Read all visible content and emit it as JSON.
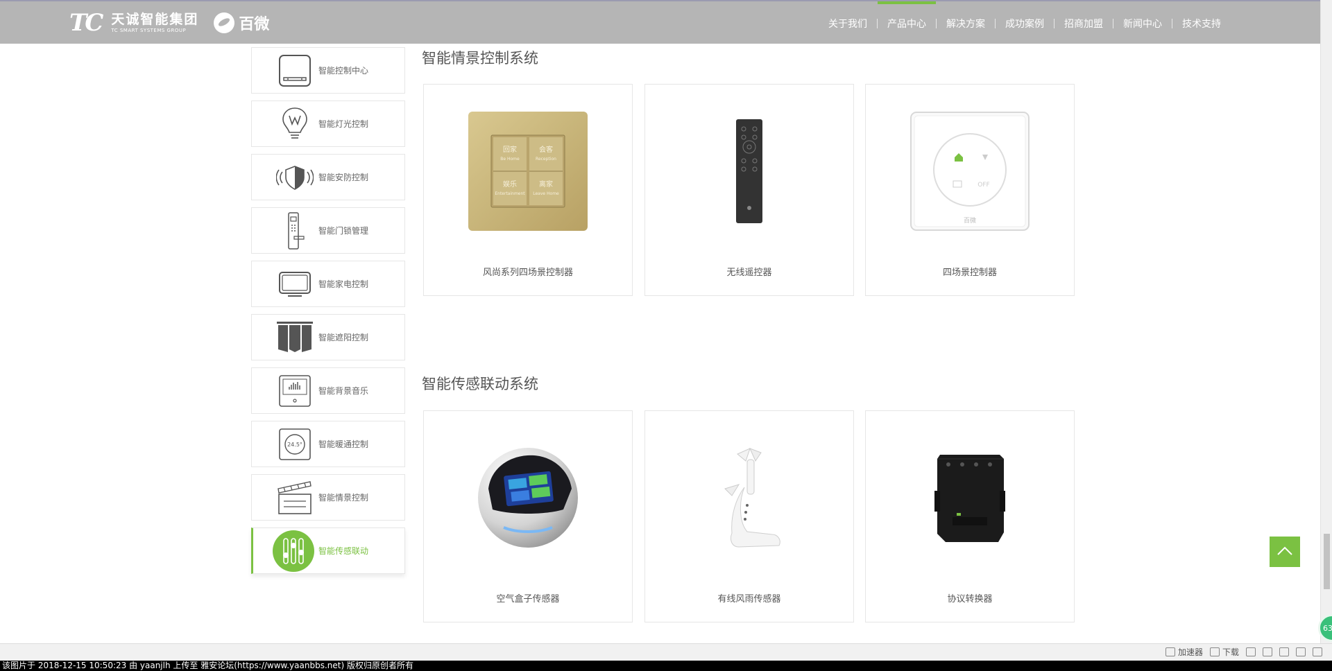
{
  "brand": {
    "mark": "TC",
    "group_cn": "天诚智能集团",
    "group_en": "TC SMART SYSTEMS GROUP",
    "sub_brand": "百微"
  },
  "nav": [
    {
      "label": "关于我们",
      "active": false
    },
    {
      "label": "产品中心",
      "active": true
    },
    {
      "label": "解决方案",
      "active": false
    },
    {
      "label": "成功案例",
      "active": false
    },
    {
      "label": "招商加盟",
      "active": false
    },
    {
      "label": "新闻中心",
      "active": false
    },
    {
      "label": "技术支持",
      "active": false
    }
  ],
  "sidebar": [
    {
      "label": "智能控制中心",
      "icon": "control-panel-icon"
    },
    {
      "label": "智能灯光控制",
      "icon": "light-bulb-icon"
    },
    {
      "label": "智能安防控制",
      "icon": "shield-icon"
    },
    {
      "label": "智能门锁管理",
      "icon": "door-lock-icon"
    },
    {
      "label": "智能家电控制",
      "icon": "tv-icon"
    },
    {
      "label": "智能遮阳控制",
      "icon": "curtain-icon"
    },
    {
      "label": "智能背景音乐",
      "icon": "music-panel-icon"
    },
    {
      "label": "智能暖通控制",
      "icon": "thermostat-icon",
      "icon_text": "24.5°"
    },
    {
      "label": "智能情景控制",
      "icon": "scene-clapper-icon"
    },
    {
      "label": "智能传感联动",
      "icon": "sensor-sliders-icon",
      "active": true
    }
  ],
  "sections": [
    {
      "title": "智能情景控制系统",
      "products": [
        {
          "name": "风尚系列四场景控制器",
          "image": "gold-scene-panel-image",
          "buttons": [
            {
              "cn": "回家",
              "en": "Be Home"
            },
            {
              "cn": "会客",
              "en": "Reception"
            },
            {
              "cn": "娱乐",
              "en": "Entertainment"
            },
            {
              "cn": "离家",
              "en": "Leave Home"
            }
          ]
        },
        {
          "name": "无线遥控器",
          "image": "remote-control-image"
        },
        {
          "name": "四场景控制器",
          "image": "white-scene-panel-image",
          "panel_off_label": "OFF",
          "panel_brand": "百微"
        }
      ]
    },
    {
      "title": "智能传感联动系统",
      "products": [
        {
          "name": "空气盒子传感器",
          "image": "air-box-sensor-image"
        },
        {
          "name": "有线风雨传感器",
          "image": "wind-rain-sensor-image"
        },
        {
          "name": "协议转换器",
          "image": "protocol-converter-image"
        }
      ]
    }
  ],
  "float_badge": "63",
  "statusbar": {
    "tools": [
      "加速器",
      "下载"
    ]
  },
  "watermark": "该图片于 2018-12-15 10:50:23 由 yaanjlh 上传至 雅安论坛(https://www.yaanbbs.net) 版权归原创者所有",
  "colors": {
    "accent": "#7bc142",
    "header_bg": "#b5b5b5",
    "border": "#e6e6e6"
  }
}
